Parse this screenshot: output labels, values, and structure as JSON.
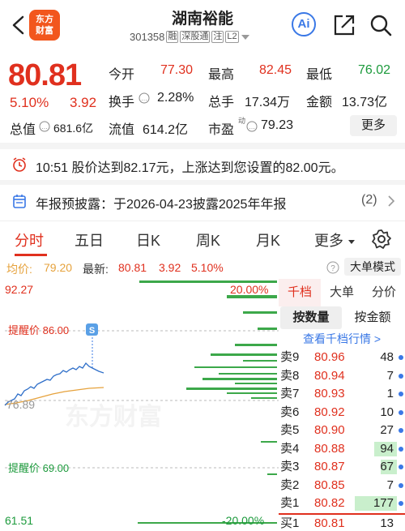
{
  "header": {
    "logo_line1": "东方",
    "logo_line2": "财富",
    "stock_name": "湖南裕能",
    "stock_code": "301358",
    "tags": [
      "融",
      "深股通",
      "注",
      "L2"
    ],
    "ai_label": "Ai"
  },
  "quote": {
    "price": "80.81",
    "change_pct": "5.10%",
    "change": "3.92",
    "open_label": "今开",
    "open": "77.30",
    "high_label": "最高",
    "high": "82.45",
    "low_label": "最低",
    "low": "76.02",
    "turnover_label": "换手",
    "turnover": "2.28%",
    "volume_label": "总手",
    "volume": "17.34万",
    "amount_label": "金额",
    "amount": "13.73亿",
    "total_mv_label": "总值",
    "total_mv": "681.6亿",
    "float_mv_label": "流值",
    "float_mv": "614.2亿",
    "pe_label": "市盈",
    "pe_sup": "动",
    "pe": "79.23",
    "more_label": "更多"
  },
  "alert": {
    "text": "10:51 股价达到82.17元，上涨达到您设置的82.00元。"
  },
  "announcement": {
    "text": "年报预披露：于2026-04-23披露2025年年报",
    "count": "(2)"
  },
  "tabs": [
    "分时",
    "五日",
    "日K",
    "周K",
    "月K",
    "更多"
  ],
  "avg_bar": {
    "avg_label": "均价:",
    "avg": "79.20",
    "latest_label": "最新:",
    "latest": "80.81",
    "chg": "3.92",
    "pct": "5.10%",
    "big_order_label": "大单模式"
  },
  "chart": {
    "y_top": "92.27",
    "y_bottom": "61.51",
    "pct_top": "20.00%",
    "pct_bottom": "-20.00%",
    "mid_label": "76.89",
    "alert_high": "提醒价 86.00",
    "alert_low": "提醒价 69.00",
    "s_marker": "S",
    "watermark": "东方财富"
  },
  "order_book": {
    "tabs": [
      "千档",
      "大单",
      "分价"
    ],
    "sub_tabs": [
      "按数量",
      "按金额"
    ],
    "link": "查看千档行情 >",
    "asks": [
      {
        "label": "卖9",
        "price": "80.96",
        "qty": "48",
        "fill": 0
      },
      {
        "label": "卖8",
        "price": "80.94",
        "qty": "7",
        "fill": 0
      },
      {
        "label": "卖7",
        "price": "80.93",
        "qty": "1",
        "fill": 0
      },
      {
        "label": "卖6",
        "price": "80.92",
        "qty": "10",
        "fill": 0
      },
      {
        "label": "卖5",
        "price": "80.90",
        "qty": "27",
        "fill": 0
      },
      {
        "label": "卖4",
        "price": "80.88",
        "qty": "94",
        "fill": 0.53
      },
      {
        "label": "卖3",
        "price": "80.87",
        "qty": "67",
        "fill": 0.38
      },
      {
        "label": "卖2",
        "price": "80.85",
        "qty": "7",
        "fill": 0
      },
      {
        "label": "卖1",
        "price": "80.82",
        "qty": "177",
        "fill": 1
      }
    ],
    "bid1": {
      "label": "买1",
      "price": "80.81",
      "qty": "13"
    }
  }
}
